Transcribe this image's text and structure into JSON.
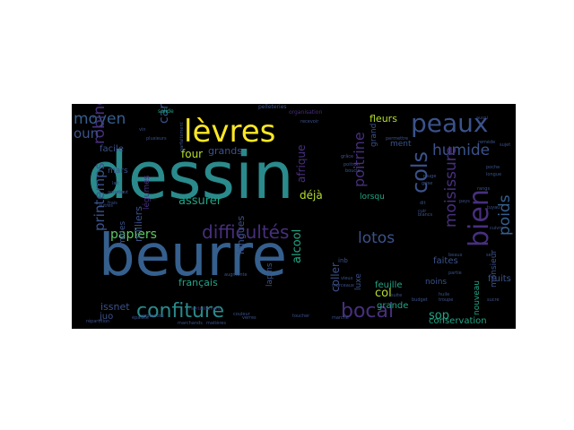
{
  "palette": {
    "background": "#000000",
    "teal": "#2a8a8c",
    "blue": "#355f8d",
    "purple": "#472f7d",
    "indigo": "#3b528b",
    "green": "#5ec962",
    "lime": "#b5de2b",
    "yellow": "#fde725",
    "seagreen": "#21a585",
    "dark": "#3e4989"
  },
  "words": [
    {
      "text": "dessin",
      "color": "teal"
    },
    {
      "text": "beurre",
      "color": "blue"
    },
    {
      "text": "lèvres",
      "color": "yellow"
    },
    {
      "text": "peaux",
      "color": "indigo"
    },
    {
      "text": "confiture",
      "color": "teal"
    },
    {
      "text": "difficultés",
      "color": "purple"
    },
    {
      "text": "bocal",
      "color": "purple"
    },
    {
      "text": "bien",
      "color": "purple"
    },
    {
      "text": "cols",
      "color": "indigo"
    },
    {
      "text": "moyen",
      "color": "blue"
    },
    {
      "text": "humide",
      "color": "indigo"
    },
    {
      "text": "moisissure",
      "color": "purple"
    },
    {
      "text": "poids",
      "color": "blue"
    },
    {
      "text": "robinet",
      "color": "purple"
    },
    {
      "text": "printemps",
      "color": "indigo"
    },
    {
      "text": "papiers",
      "color": "green"
    },
    {
      "text": "lotos",
      "color": "indigo"
    },
    {
      "text": "poitrine",
      "color": "purple"
    },
    {
      "text": "oun",
      "color": "indigo"
    },
    {
      "text": "assurer",
      "color": "seagreen"
    },
    {
      "text": "cartons",
      "color": "indigo"
    },
    {
      "text": "alcool",
      "color": "seagreen"
    },
    {
      "text": "sop",
      "color": "seagreen"
    },
    {
      "text": "col",
      "color": "lime"
    },
    {
      "text": "afrique",
      "color": "purple"
    },
    {
      "text": "fleurs",
      "color": "lime"
    },
    {
      "text": "grands",
      "color": "indigo"
    },
    {
      "text": "coller",
      "color": "indigo"
    },
    {
      "text": "four",
      "color": "lime"
    },
    {
      "text": "déjà",
      "color": "lime"
    },
    {
      "text": "milliers",
      "color": "indigo"
    },
    {
      "text": "français",
      "color": "seagreen"
    },
    {
      "text": "longues",
      "color": "indigo"
    },
    {
      "text": "conservation",
      "color": "seagreen"
    },
    {
      "text": "nouveau",
      "color": "seagreen"
    },
    {
      "text": "faites",
      "color": "indigo"
    },
    {
      "text": "grande",
      "color": "seagreen"
    },
    {
      "text": "feuille",
      "color": "seagreen"
    },
    {
      "text": "luxe",
      "color": "indigo"
    },
    {
      "text": "noins",
      "color": "indigo"
    },
    {
      "text": "issnet",
      "color": "indigo"
    },
    {
      "text": "juo",
      "color": "indigo"
    },
    {
      "text": "mines",
      "color": "indigo"
    },
    {
      "text": "lapins",
      "color": "indigo"
    },
    {
      "text": "facile",
      "color": "indigo"
    },
    {
      "text": "mars",
      "color": "indigo"
    },
    {
      "text": "légumes",
      "color": "purple"
    },
    {
      "text": "fruits",
      "color": "indigo"
    },
    {
      "text": "monsieur",
      "color": "indigo"
    },
    {
      "text": "grand",
      "color": "indigo"
    },
    {
      "text": "ment",
      "color": "indigo"
    },
    {
      "text": "lorsqu",
      "color": "seagreen"
    },
    {
      "text": "solide",
      "color": "seagreen"
    },
    {
      "text": "pelleteries",
      "color": "indigo"
    },
    {
      "text": "organisation",
      "color": "purple"
    },
    {
      "text": "aussi",
      "color": "indigo"
    },
    {
      "text": "sujet",
      "color": "indigo"
    },
    {
      "text": "remède",
      "color": "indigo"
    },
    {
      "text": "poitron",
      "color": "indigo"
    },
    {
      "text": "boucle",
      "color": "indigo"
    },
    {
      "text": "toucher",
      "color": "indigo"
    },
    {
      "text": "suite",
      "color": "indigo"
    },
    {
      "text": "dit",
      "color": "indigo"
    },
    {
      "text": "cuir",
      "color": "indigo"
    },
    {
      "text": "parfaitement",
      "color": "indigo"
    },
    {
      "text": "inb",
      "color": "indigo"
    },
    {
      "text": "ravitaillement",
      "color": "purple"
    },
    {
      "text": "plusieurs",
      "color": "indigo"
    },
    {
      "text": "vin",
      "color": "indigo"
    },
    {
      "text": "répartition",
      "color": "indigo"
    },
    {
      "text": "augmente",
      "color": "indigo"
    },
    {
      "text": "permettre",
      "color": "indigo"
    },
    {
      "text": "blancs",
      "color": "indigo"
    },
    {
      "text": "beaux",
      "color": "indigo"
    },
    {
      "text": "partie",
      "color": "indigo"
    },
    {
      "text": "pays",
      "color": "indigo"
    },
    {
      "text": "grâce",
      "color": "indigo"
    },
    {
      "text": "recevoir",
      "color": "indigo"
    },
    {
      "text": "marché",
      "color": "indigo"
    },
    {
      "text": "matières",
      "color": "indigo"
    },
    {
      "text": "marchands",
      "color": "indigo"
    },
    {
      "text": "tuyau",
      "color": "indigo"
    },
    {
      "text": "cuivre",
      "color": "indigo"
    },
    {
      "text": "apprendre",
      "color": "indigo"
    },
    {
      "text": "lait",
      "color": "indigo"
    },
    {
      "text": "surtout",
      "color": "indigo"
    },
    {
      "text": "épaisse",
      "color": "indigo"
    },
    {
      "text": "rouge",
      "color": "indigo"
    },
    {
      "text": "grise",
      "color": "indigo"
    },
    {
      "text": "poche",
      "color": "indigo"
    },
    {
      "text": "longue",
      "color": "indigo"
    },
    {
      "text": "sucre",
      "color": "indigo"
    },
    {
      "text": "sel",
      "color": "indigo"
    },
    {
      "text": "vieux",
      "color": "indigo"
    },
    {
      "text": "morceaux",
      "color": "indigo"
    },
    {
      "text": "rangs",
      "color": "indigo"
    },
    {
      "text": "troupe",
      "color": "indigo"
    },
    {
      "text": "huile",
      "color": "indigo"
    },
    {
      "text": "autres",
      "color": "indigo"
    },
    {
      "text": "frais",
      "color": "indigo"
    },
    {
      "text": "acheter",
      "color": "indigo"
    },
    {
      "text": "budget",
      "color": "indigo"
    },
    {
      "text": "verres",
      "color": "indigo"
    },
    {
      "text": "couleur",
      "color": "indigo"
    }
  ]
}
